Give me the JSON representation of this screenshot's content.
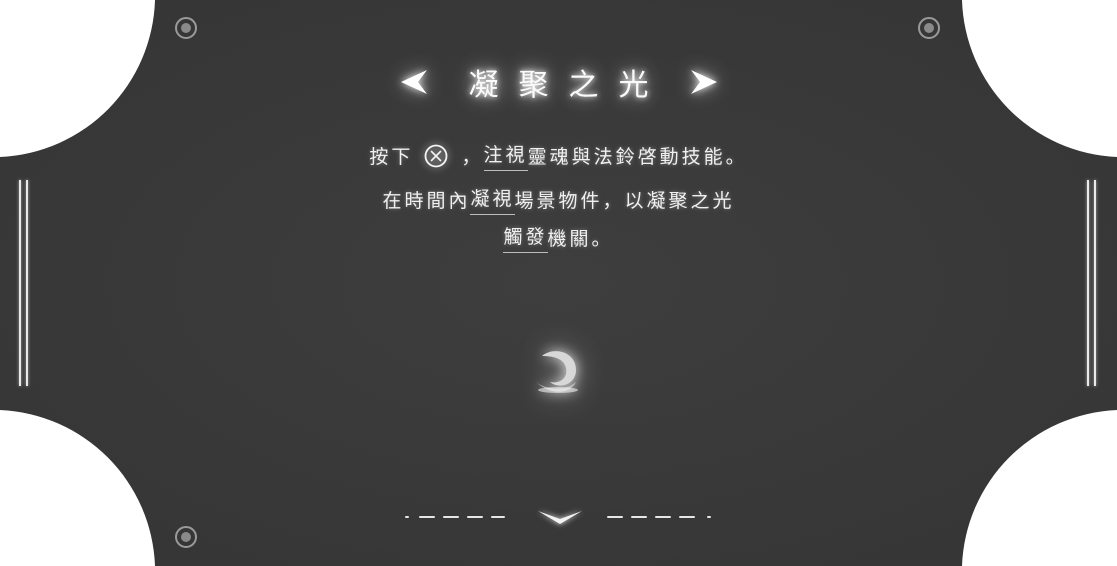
{
  "title": "凝聚之光",
  "instructions": {
    "line1": {
      "prefix": "按下",
      "button_icon": "cross-button-icon",
      "comma": "，",
      "underlined": "注視",
      "rest": "靈魂與法鈴啓動技能。"
    },
    "line2": {
      "prefix": "在時間內",
      "underlined": "凝視",
      "rest": "場景物件，以凝聚之光"
    },
    "line3": {
      "underlined": "觸發",
      "rest": "機關。"
    }
  },
  "icons": {
    "title_left": "chevron-left-icon",
    "title_right": "chevron-right-icon",
    "center": "soul-swirl-icon",
    "bottom": "chevron-down-icon"
  },
  "colors": {
    "panel": "#3b3b3b",
    "text": "#f0f0f0",
    "glow": "#ffffff",
    "outside": "#ffffff"
  }
}
